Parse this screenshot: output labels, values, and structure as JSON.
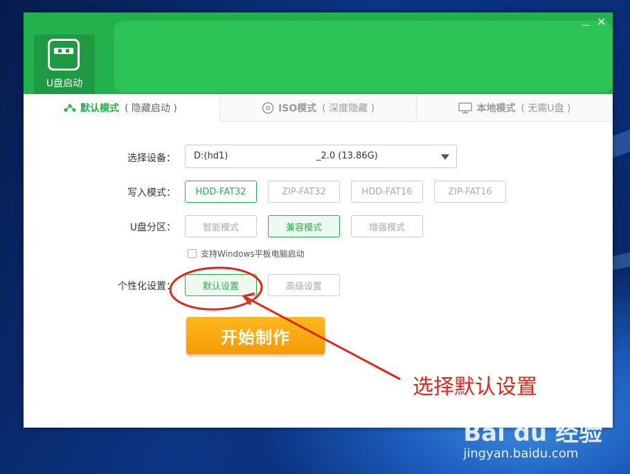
{
  "app": {
    "logo_label": "U盘启动",
    "close_glyph": "✕",
    "min_glyph": "—"
  },
  "tabs": [
    {
      "title": "默认模式",
      "sub": "( 隐藏启动 )",
      "icon": "share-node-icon",
      "active": true
    },
    {
      "title": "ISO模式",
      "sub": "( 深度隐藏 )",
      "icon": "disc-icon",
      "active": false
    },
    {
      "title": "本地模式",
      "sub": "( 无需U盘 )",
      "icon": "monitor-icon",
      "active": false
    }
  ],
  "form": {
    "device_label": "选择设备：",
    "device_value_prefix": "D:(hd1)",
    "device_value_suffix": "_2.0 (13.86G)",
    "write_label": "写入模式：",
    "write_options": [
      "HDD-FAT32",
      "ZIP-FAT32",
      "HDD-FAT16",
      "ZIP-FAT16"
    ],
    "write_selected": "HDD-FAT32",
    "partition_label": "U盘分区：",
    "partition_options": [
      "智能模式",
      "兼容模式",
      "增强模式"
    ],
    "partition_selected": "兼容模式",
    "tablet_checkbox": "支持Windows平板电脑启动",
    "tablet_checked": false,
    "personal_label": "个性化设置：",
    "personal_options": [
      "默认设置",
      "高级设置"
    ],
    "personal_selected": "默认设置",
    "start_button": "开始制作"
  },
  "annotation": {
    "text": "选择默认设置",
    "color": "#e0261a"
  },
  "watermark": {
    "logo": "Bai du 经验",
    "url": "jingyan.baidu.com"
  },
  "colors": {
    "brand_green": "#23b14c",
    "start_orange": "#f7a40e"
  }
}
